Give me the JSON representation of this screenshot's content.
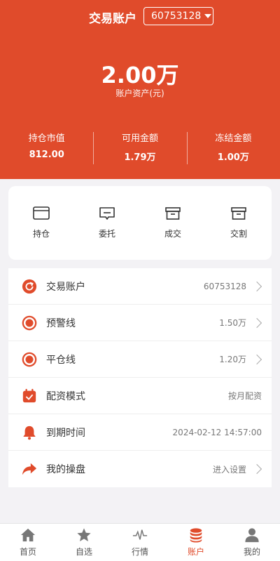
{
  "header": {
    "title": "交易账户",
    "account_number": "60753128",
    "total_assets": "2.00万",
    "total_assets_label": "账户资产(元)",
    "stats": [
      {
        "label": "持仓市值",
        "value": "812.00"
      },
      {
        "label": "可用金额",
        "value": "1.79万"
      },
      {
        "label": "冻结金额",
        "value": "1.00万"
      }
    ]
  },
  "actions": [
    {
      "label": "持仓",
      "icon": "card-icon"
    },
    {
      "label": "委托",
      "icon": "message-icon"
    },
    {
      "label": "成交",
      "icon": "box-icon"
    },
    {
      "label": "交割",
      "icon": "box-icon"
    }
  ],
  "list": [
    {
      "name": "交易账户",
      "value": "60753128",
      "icon": "refresh-icon",
      "arrow": true
    },
    {
      "name": "预警线",
      "value": "1.50万",
      "icon": "ring-icon",
      "arrow": true
    },
    {
      "name": "平仓线",
      "value": "1.20万",
      "icon": "ring-icon",
      "arrow": true
    },
    {
      "name": "配资模式",
      "value": "按月配资",
      "icon": "calendar-check-icon",
      "arrow": false
    },
    {
      "name": "到期时间",
      "value": "2024-02-12 14:57:00",
      "icon": "bell-icon",
      "arrow": false
    },
    {
      "name": "我的操盘",
      "value": "进入设置",
      "icon": "share-arrow-icon",
      "arrow": true
    }
  ],
  "tabbar": [
    {
      "label": "首页",
      "icon": "home-icon"
    },
    {
      "label": "自选",
      "icon": "star-icon"
    },
    {
      "label": "行情",
      "icon": "pulse-icon"
    },
    {
      "label": "账户",
      "icon": "coins-icon",
      "active": true
    },
    {
      "label": "我的",
      "icon": "user-icon"
    }
  ],
  "colors": {
    "accent": "#e04b2b",
    "tab_inactive": "#777777"
  }
}
